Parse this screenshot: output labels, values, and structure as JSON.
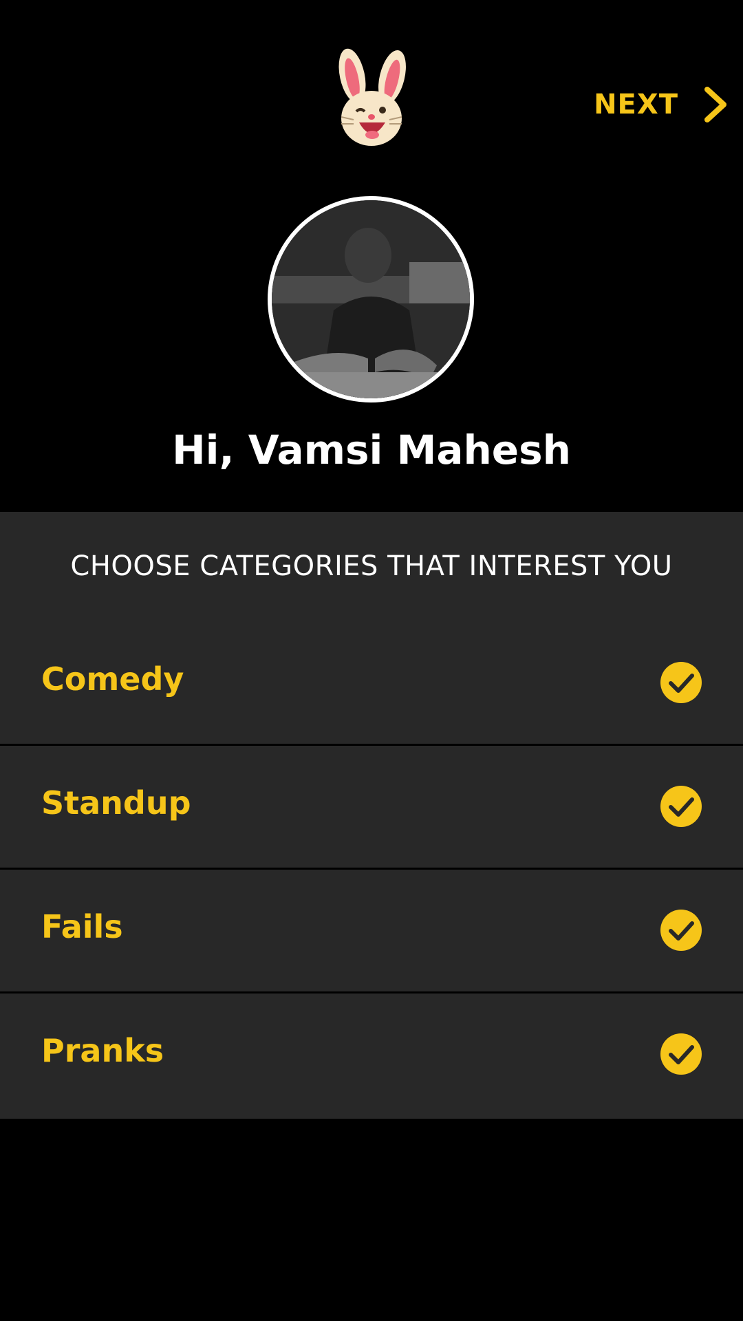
{
  "header": {
    "logo_icon": "bunny-mascot-icon",
    "next_label": "NEXT",
    "next_icon": "chevron-right-icon"
  },
  "profile": {
    "avatar_icon": "user-avatar",
    "greeting": "Hi, Vamsi Mahesh"
  },
  "categories": {
    "title": "CHOOSE CATEGORIES THAT INTEREST YOU",
    "items": [
      {
        "label": "Comedy",
        "selected": true
      },
      {
        "label": "Standup",
        "selected": true
      },
      {
        "label": "Fails",
        "selected": true
      },
      {
        "label": "Pranks",
        "selected": true
      }
    ]
  },
  "colors": {
    "background": "#000000",
    "panel": "#282828",
    "accent": "#F6C519",
    "text": "#FFFFFF"
  }
}
